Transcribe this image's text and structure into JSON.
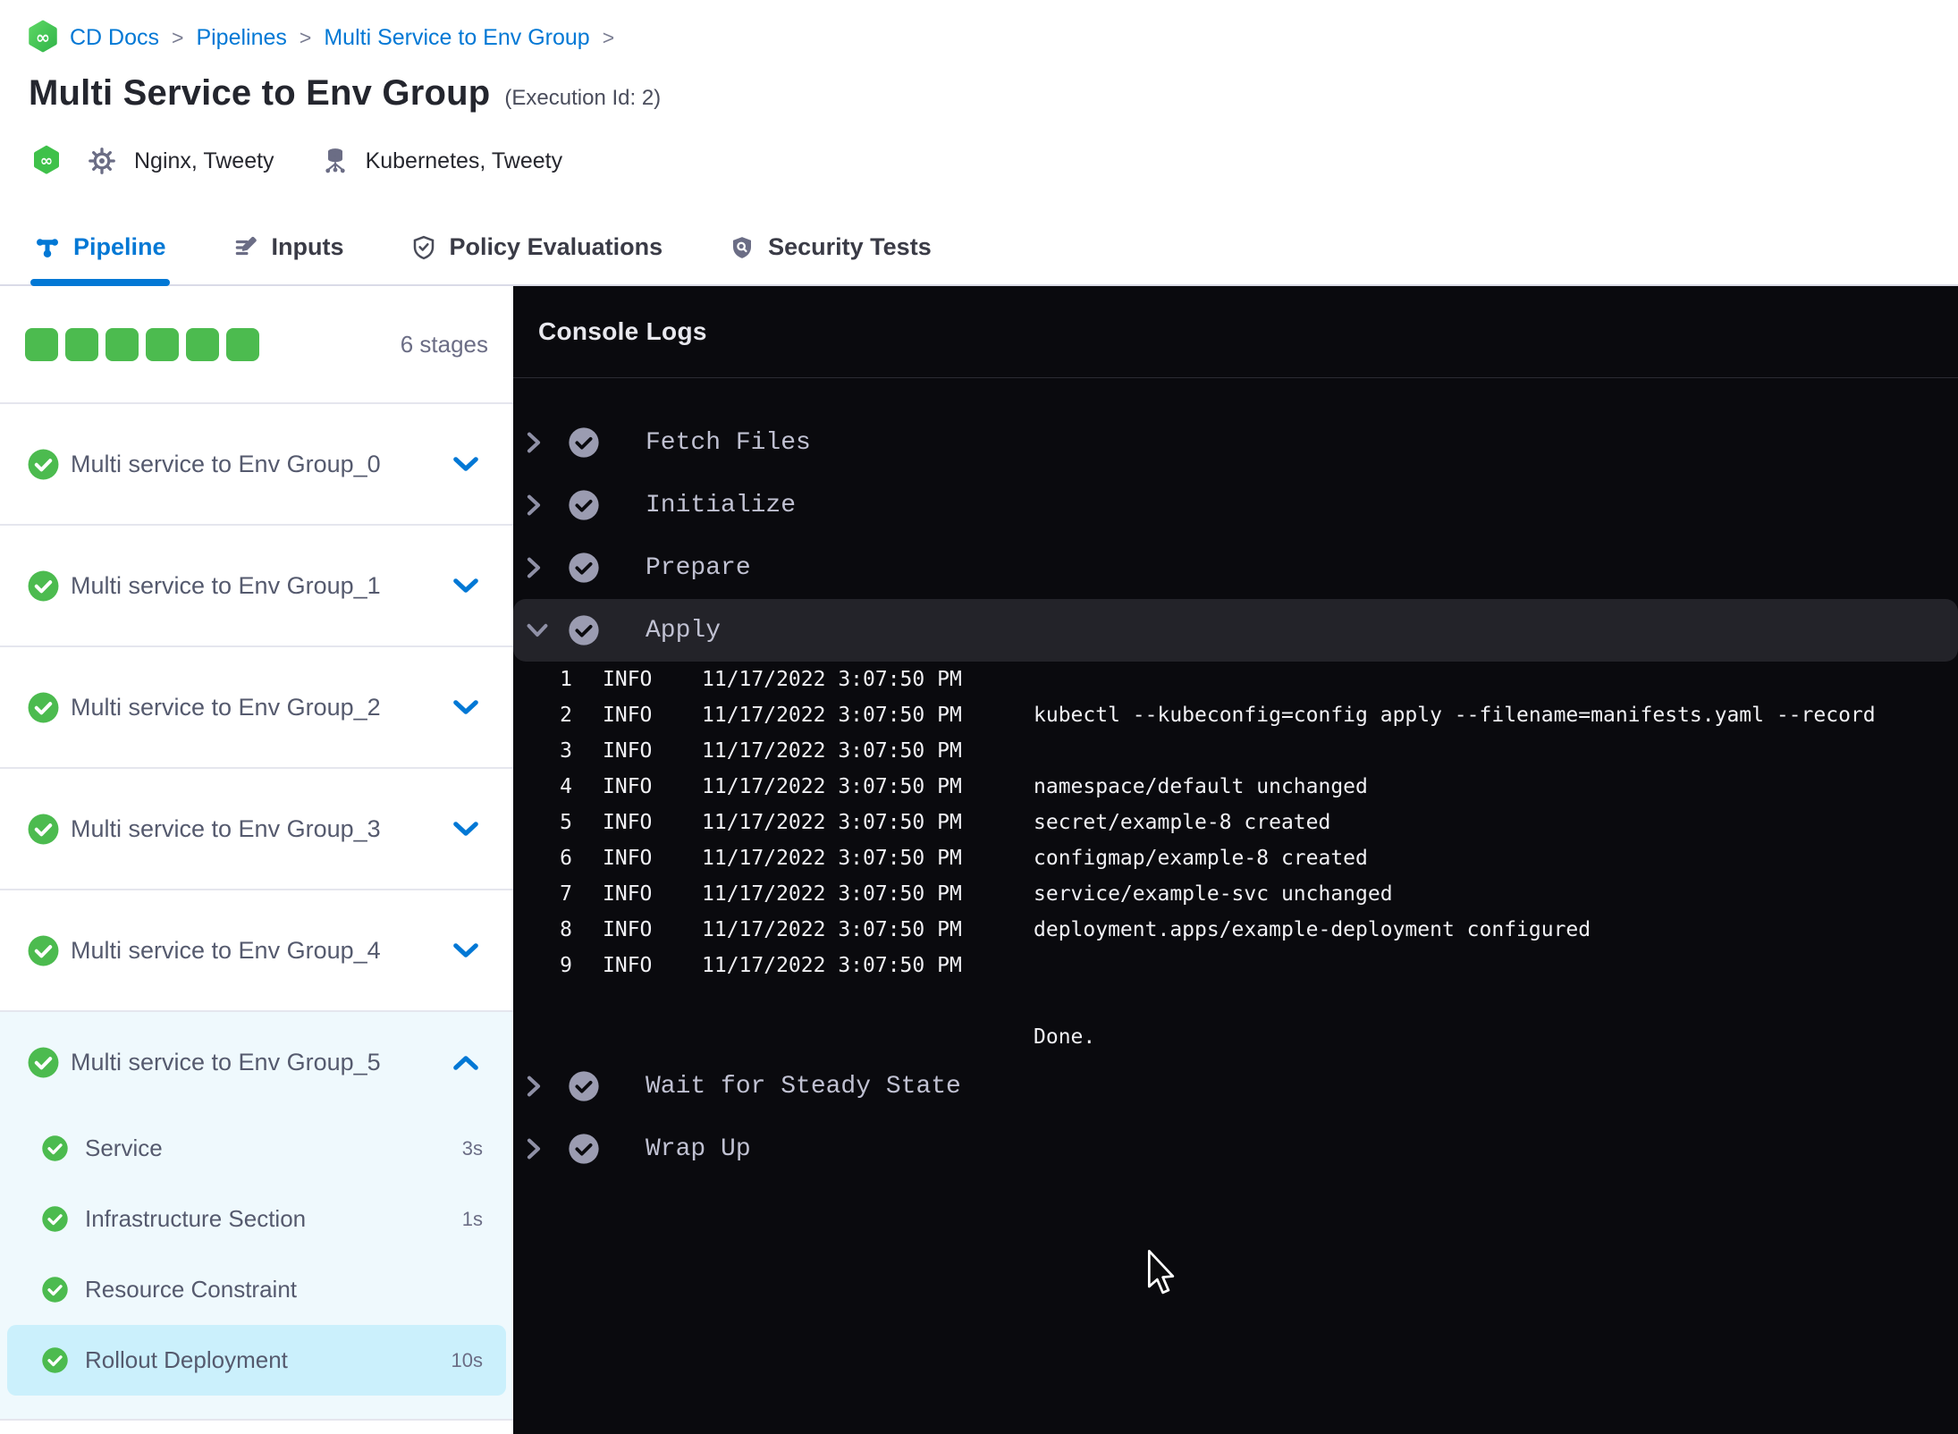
{
  "breadcrumb": {
    "items": [
      "CD Docs",
      "Pipelines",
      "Multi Service to Env Group"
    ],
    "separator": ">"
  },
  "header": {
    "title": "Multi Service to Env Group",
    "execution_id": "(Execution Id: 2)",
    "service_label": "Nginx, Tweety",
    "infra_label": "Kubernetes, Tweety"
  },
  "tabs": [
    {
      "label": "Pipeline",
      "active": true
    },
    {
      "label": "Inputs"
    },
    {
      "label": "Policy Evaluations"
    },
    {
      "label": "Security Tests"
    }
  ],
  "sidebar": {
    "squares": 6,
    "stage_count_label": "6 stages",
    "stages": [
      {
        "label": "Multi service to Env Group_0"
      },
      {
        "label": "Multi service to Env Group_1"
      },
      {
        "label": "Multi service to Env Group_2"
      },
      {
        "label": "Multi service to Env Group_3"
      },
      {
        "label": "Multi service to Env Group_4"
      },
      {
        "label": "Multi service to Env Group_5",
        "expanded": true,
        "steps": [
          {
            "label": "Service",
            "duration": "3s"
          },
          {
            "label": "Infrastructure Section",
            "duration": "1s"
          },
          {
            "label": "Resource Constraint",
            "duration": ""
          },
          {
            "label": "Rollout Deployment",
            "duration": "10s",
            "selected": true
          }
        ]
      }
    ]
  },
  "console": {
    "title": "Console Logs",
    "sections": [
      {
        "label": "Fetch Files"
      },
      {
        "label": "Initialize"
      },
      {
        "label": "Prepare"
      },
      {
        "label": "Apply",
        "expanded": true,
        "logs": [
          {
            "n": "1",
            "level": "INFO",
            "time": "11/17/2022 3:07:50 PM",
            "msg": ""
          },
          {
            "n": "2",
            "level": "INFO",
            "time": "11/17/2022 3:07:50 PM",
            "msg": "kubectl --kubeconfig=config apply --filename=manifests.yaml --record"
          },
          {
            "n": "3",
            "level": "INFO",
            "time": "11/17/2022 3:07:50 PM",
            "msg": ""
          },
          {
            "n": "4",
            "level": "INFO",
            "time": "11/17/2022 3:07:50 PM",
            "msg": "namespace/default unchanged"
          },
          {
            "n": "5",
            "level": "INFO",
            "time": "11/17/2022 3:07:50 PM",
            "msg": "secret/example-8 created"
          },
          {
            "n": "6",
            "level": "INFO",
            "time": "11/17/2022 3:07:50 PM",
            "msg": "configmap/example-8 created"
          },
          {
            "n": "7",
            "level": "INFO",
            "time": "11/17/2022 3:07:50 PM",
            "msg": "service/example-svc unchanged"
          },
          {
            "n": "8",
            "level": "INFO",
            "time": "11/17/2022 3:07:50 PM",
            "msg": "deployment.apps/example-deployment configured"
          },
          {
            "n": "9",
            "level": "INFO",
            "time": "11/17/2022 3:07:50 PM",
            "msg": ""
          },
          {
            "n": "",
            "level": "",
            "time": "",
            "msg": ""
          },
          {
            "n": "",
            "level": "",
            "time": "",
            "msg": "Done."
          }
        ]
      },
      {
        "label": "Wait for Steady State"
      },
      {
        "label": "Wrap Up"
      }
    ]
  },
  "colors": {
    "primary_blue": "#0278D5",
    "success_green": "#4CBB4F",
    "title_text": "#24262E",
    "stage_text": "#555A6E",
    "divider": "#E5E6EE",
    "expanded_bg": "#EFF9FD",
    "selected_step_bg": "#CBF0FC",
    "console_bg": "#0A0A0E",
    "console_highlight": "#232329",
    "console_border": "#2B2B33",
    "console_label": "#C0C1D2",
    "console_icon": "#9B9CB1",
    "log_text": "#F1F1F5"
  }
}
